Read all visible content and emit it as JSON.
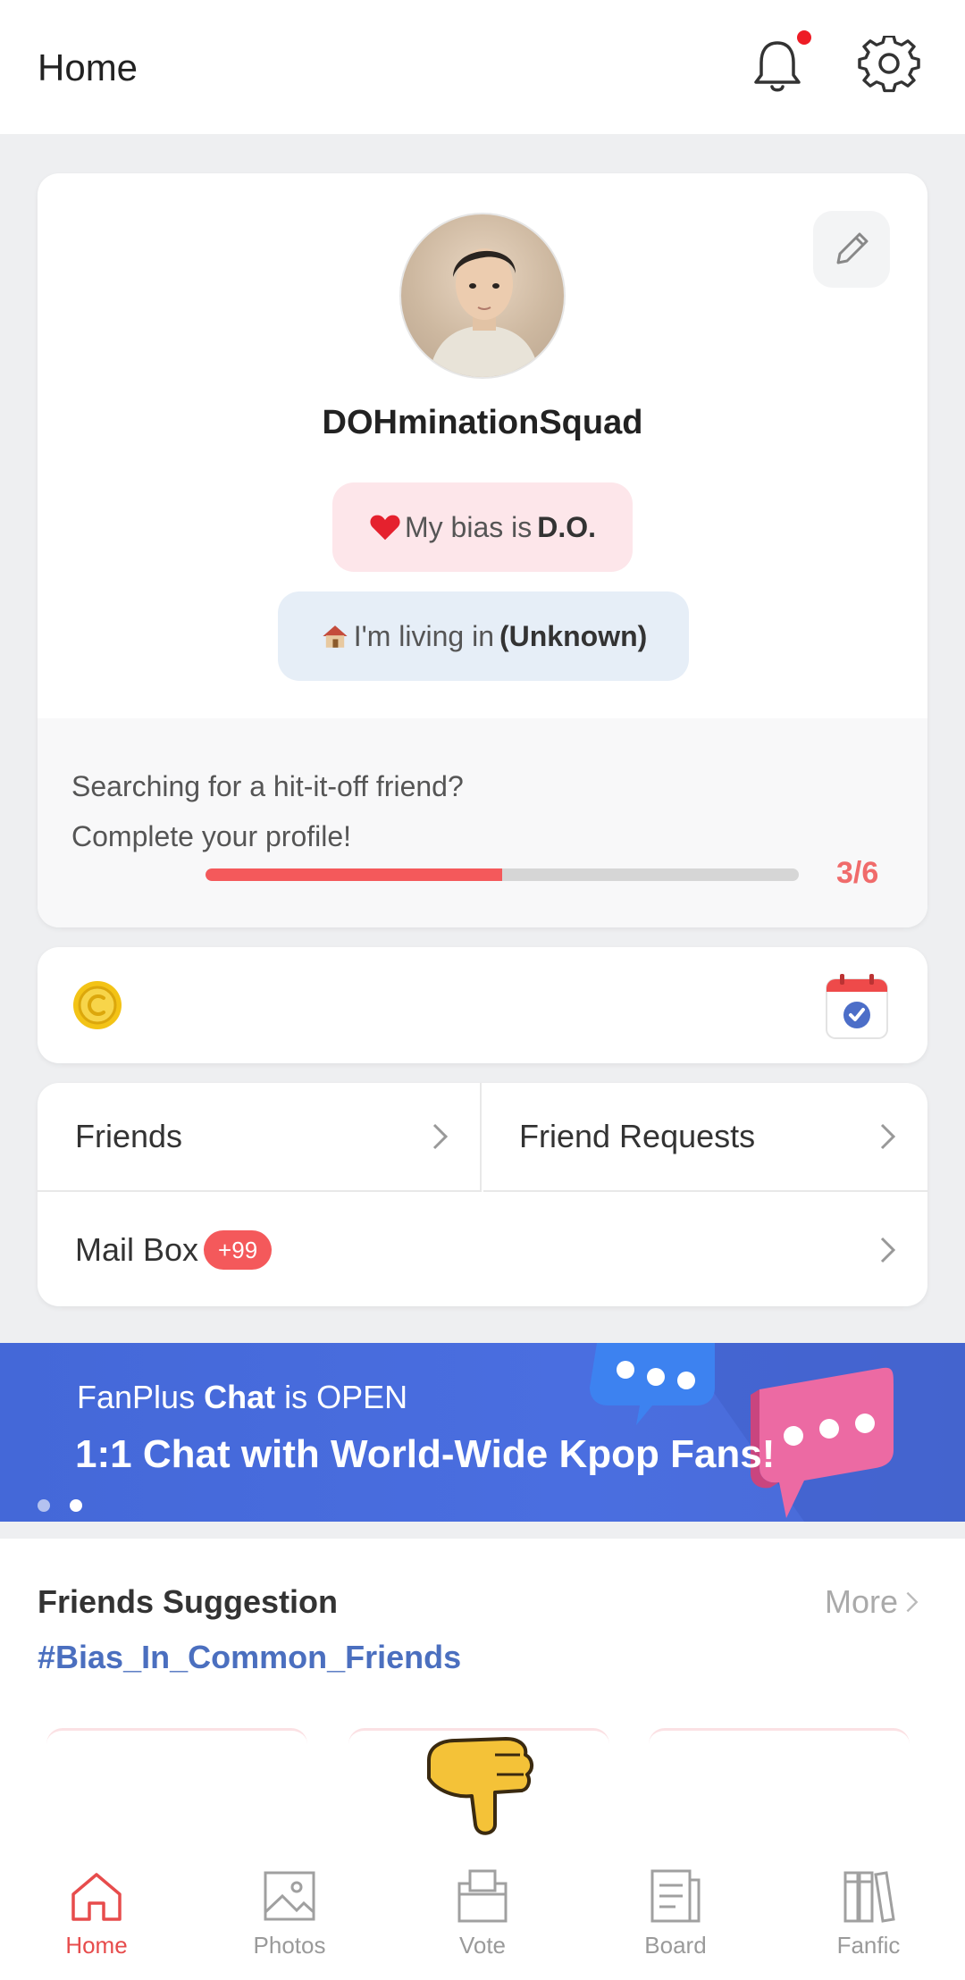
{
  "header": {
    "title": "Home",
    "has_notification": true
  },
  "profile": {
    "username": "DOHminationSquad",
    "bias_prefix": "My bias is",
    "bias_value": "D.O.",
    "living_prefix": "I'm living in",
    "living_value": "(Unknown)",
    "prompt_line1": "Searching for a hit-it-off friend?",
    "prompt_line2": "Complete your profile!",
    "progress_label": "3/6",
    "progress_fraction": 0.5
  },
  "menu": {
    "friends": "Friends",
    "friend_requests": "Friend Requests",
    "mail_box": "Mail Box",
    "mail_badge": "+99"
  },
  "banner": {
    "line1_brand": "FanPlus",
    "line1_bold": "Chat",
    "line1_suffix": "is OPEN",
    "line2": "1:1 Chat with World-Wide Kpop Fans!",
    "active_dot": 1
  },
  "suggestion": {
    "title": "Friends Suggestion",
    "more": "More",
    "tag": "#Bias_In_Common_Friends"
  },
  "tabs": [
    {
      "label": "Home",
      "icon": "home-icon",
      "active": true
    },
    {
      "label": "Photos",
      "icon": "photos-icon",
      "active": false
    },
    {
      "label": "Vote",
      "icon": "vote-icon",
      "active": false
    },
    {
      "label": "Board",
      "icon": "board-icon",
      "active": false
    },
    {
      "label": "Fanfic",
      "icon": "fanfic-icon",
      "active": false
    }
  ],
  "colors": {
    "accent": "#f4595b",
    "banner": "#4a6ee0",
    "tag": "#4b6fbf",
    "bias_pill": "#fde6ea",
    "living_pill": "#e6eef7"
  }
}
